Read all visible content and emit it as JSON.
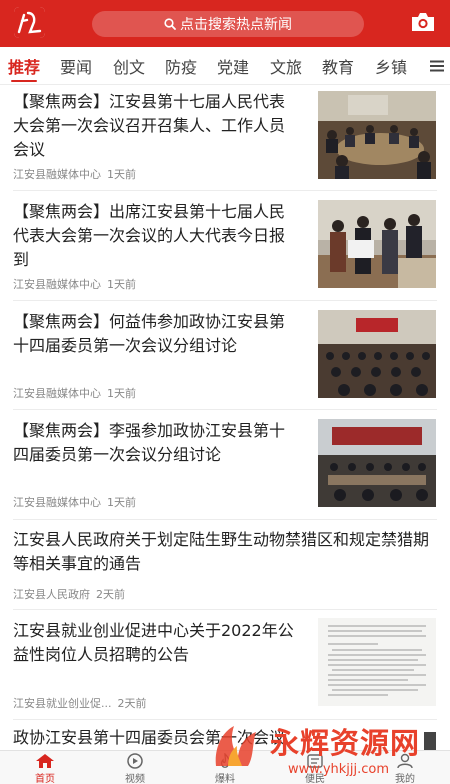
{
  "header": {
    "search_placeholder": "点击搜索热点新闻",
    "brand_color": "#d8261f"
  },
  "tabs": [
    {
      "label": "推荐",
      "active": true
    },
    {
      "label": "要闻"
    },
    {
      "label": "创文"
    },
    {
      "label": "防疫"
    },
    {
      "label": "党建"
    },
    {
      "label": "文旅"
    },
    {
      "label": "教育"
    },
    {
      "label": "乡镇"
    }
  ],
  "news": [
    {
      "title": "【聚焦两会】江安县第十七届人民代表大会第一次会议召开召集人、工作人员会议",
      "source": "江安县融媒体中心",
      "time": "1天前",
      "image": "meeting-photo"
    },
    {
      "title": "【聚焦两会】出席江安县第十七届人民代表大会第一次会议的人大代表今日报到",
      "source": "江安县融媒体中心",
      "time": "1天前",
      "image": "registration-photo"
    },
    {
      "title": "【聚焦两会】何益伟参加政协江安县第十四届委员第一次会议分组讨论",
      "source": "江安县融媒体中心",
      "time": "1天前",
      "image": "conference-hall-photo"
    },
    {
      "title": "【聚焦两会】李强参加政协江安县第十四届委员第一次会议分组讨论",
      "source": "江安县融媒体中心",
      "time": "1天前",
      "image": "discussion-photo"
    },
    {
      "title": "江安县人民政府关于划定陆生野生动物禁猎区和规定禁猎期等相关事宜的通告",
      "source": "江安县人民政府",
      "time": "2天前"
    },
    {
      "title": "江安县就业创业促进中心关于2022年公益性岗位人员招聘的公告",
      "source": "江安县就业创业促...",
      "time": "2天前",
      "image": "document-photo"
    },
    {
      "title": "政协江安县第十四届委员会第一次会议"
    }
  ],
  "bottom_nav": [
    {
      "label": "首页",
      "icon": "home-icon",
      "active": true
    },
    {
      "label": "视频",
      "icon": "play-icon"
    },
    {
      "label": "爆料",
      "icon": "fire-icon"
    },
    {
      "label": "便民",
      "icon": "service-icon"
    },
    {
      "label": "我的",
      "icon": "user-icon"
    }
  ],
  "watermark": {
    "main": "永辉资源网",
    "sub": "www.yhkjjj.com"
  }
}
